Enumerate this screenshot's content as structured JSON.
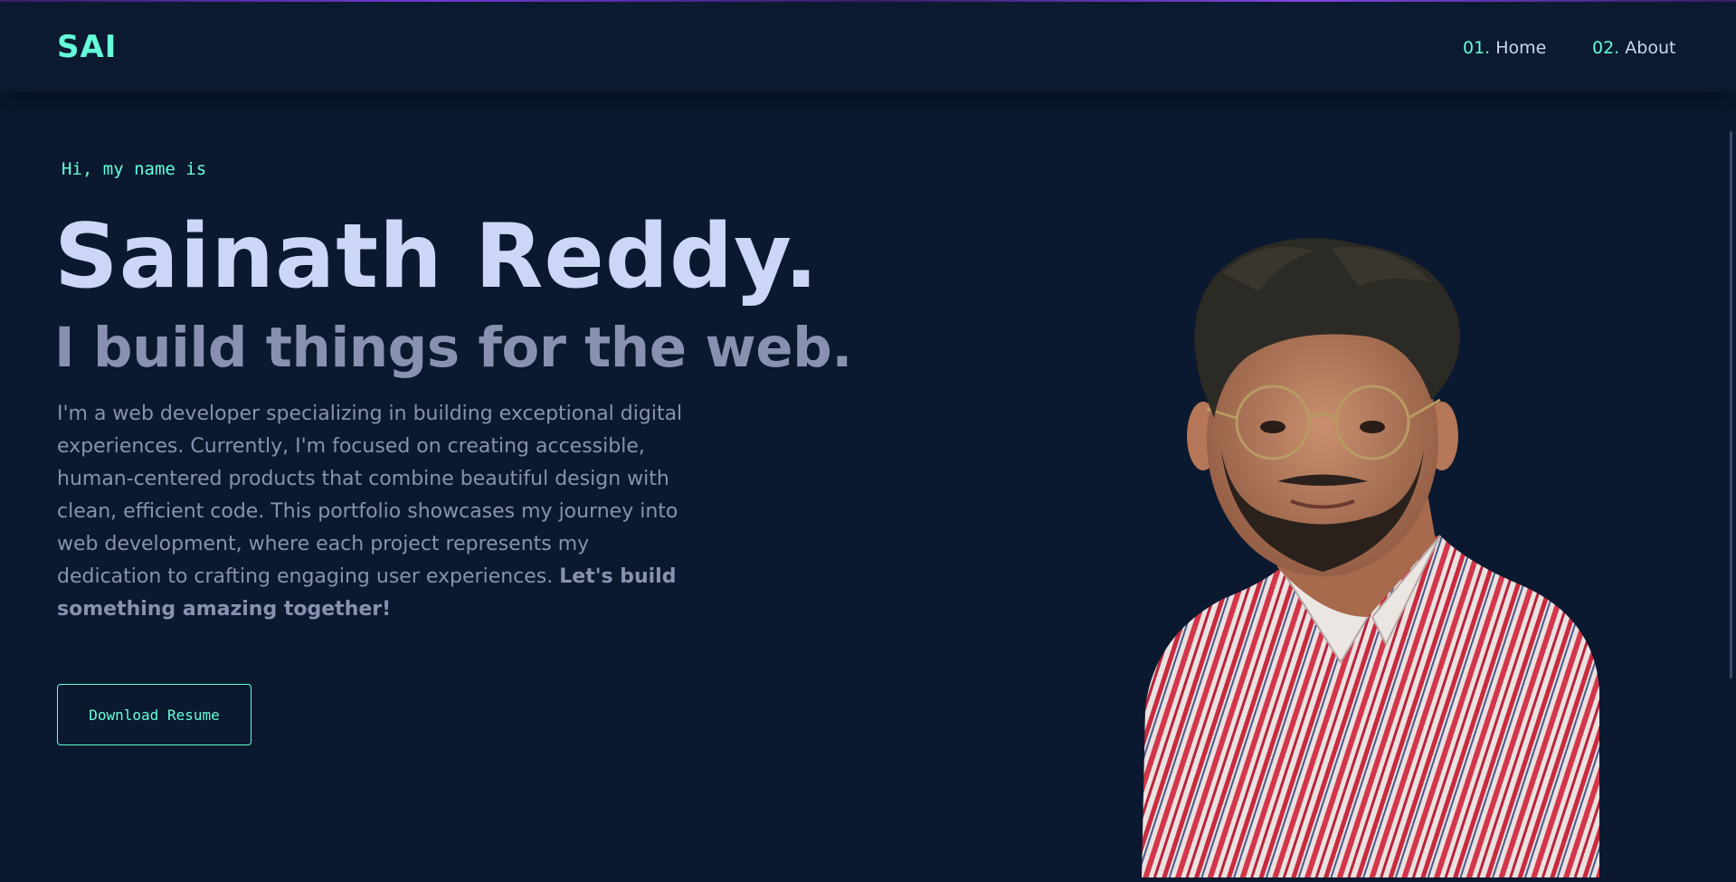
{
  "nav": {
    "logo": "SAI",
    "links": [
      {
        "num": "01.",
        "label": "Home"
      },
      {
        "num": "02.",
        "label": "About"
      }
    ]
  },
  "hero": {
    "greeting": "Hi, my name is",
    "name": "Sainath Reddy.",
    "tagline": "I build things for the web.",
    "bio": "I'm a web developer specializing in building exceptional digital experiences. Currently, I'm focused on creating accessible, human-centered products that combine beautiful design with clean, efficient code. This portfolio showcases my journey into web development, where each project represents my dedication to crafting engaging user experiences.",
    "bio_emphasis": "Let's build something amazing together!",
    "button_label": "Download Resume"
  },
  "colors": {
    "background": "#0a192f",
    "accent": "#64ffda",
    "heading": "#ccd6f6",
    "body_text": "#8892b0"
  }
}
